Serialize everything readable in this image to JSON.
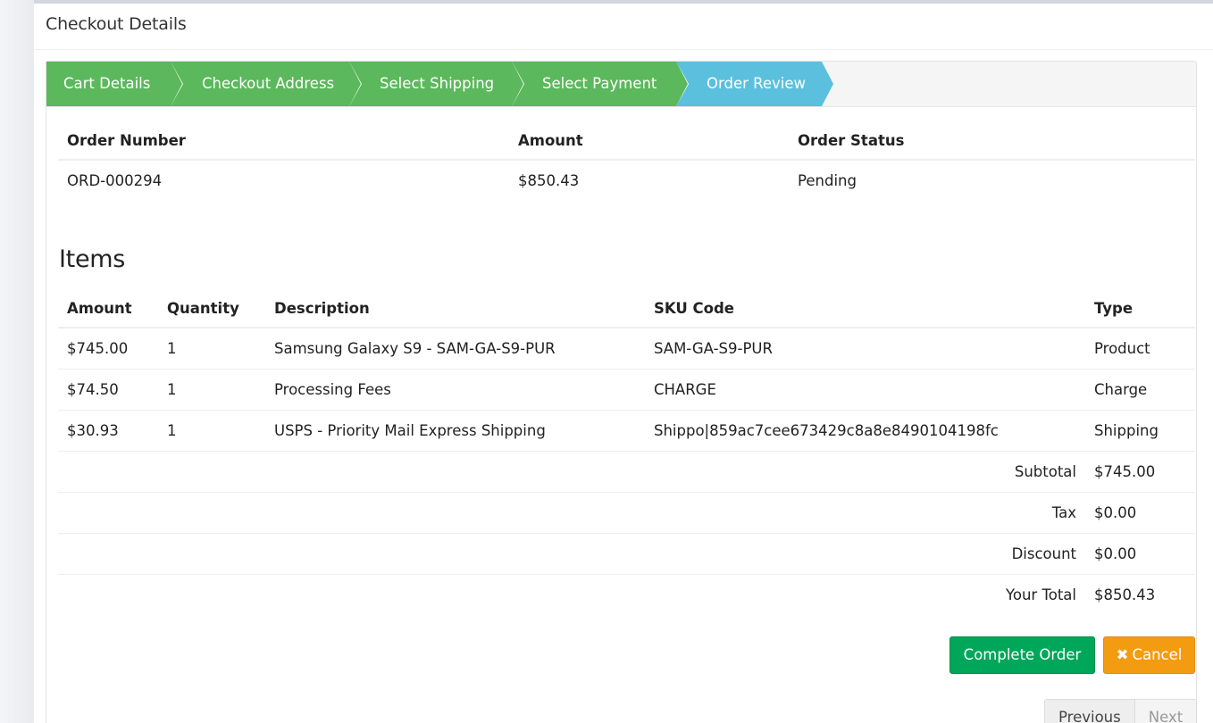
{
  "page": {
    "title": "Checkout Details"
  },
  "steps": [
    {
      "label": "Cart Details",
      "state": "done"
    },
    {
      "label": "Checkout Address",
      "state": "done"
    },
    {
      "label": "Select Shipping",
      "state": "done"
    },
    {
      "label": "Select Payment",
      "state": "done"
    },
    {
      "label": "Order Review",
      "state": "current"
    }
  ],
  "order": {
    "headers": {
      "number": "Order Number",
      "amount": "Amount",
      "status": "Order Status"
    },
    "number": "ORD-000294",
    "amount": "$850.43",
    "status": "Pending"
  },
  "items": {
    "heading": "Items",
    "headers": {
      "amount": "Amount",
      "quantity": "Quantity",
      "description": "Description",
      "sku": "SKU Code",
      "type": "Type"
    },
    "rows": [
      {
        "amount": "$745.00",
        "quantity": "1",
        "description": "Samsung Galaxy S9 - SAM-GA-S9-PUR",
        "sku": "SAM-GA-S9-PUR",
        "type": "Product"
      },
      {
        "amount": "$74.50",
        "quantity": "1",
        "description": "Processing Fees",
        "sku": "CHARGE",
        "type": "Charge"
      },
      {
        "amount": "$30.93",
        "quantity": "1",
        "description": "USPS - Priority Mail Express Shipping",
        "sku": "Shippo|859ac7cee673429c8a8e8490104198fc",
        "type": "Shipping"
      }
    ],
    "totals": [
      {
        "label": "Subtotal",
        "value": "$745.00"
      },
      {
        "label": "Tax",
        "value": "$0.00"
      },
      {
        "label": "Discount",
        "value": "$0.00"
      },
      {
        "label": "Your Total",
        "value": "$850.43"
      }
    ]
  },
  "actions": {
    "complete_label": "Complete Order",
    "cancel_icon": "times-icon",
    "cancel_label": "Cancel"
  },
  "pager": {
    "previous": "Previous",
    "next": "Next"
  },
  "colors": {
    "done": "#5cb85c",
    "current": "#5bc0de",
    "complete": "#00a65a",
    "cancel": "#f39c12"
  }
}
